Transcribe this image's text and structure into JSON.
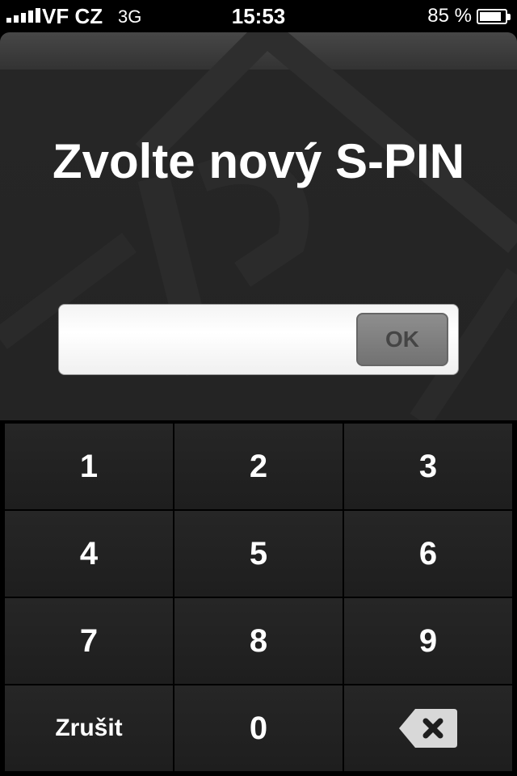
{
  "status_bar": {
    "carrier": "VF CZ",
    "network": "3G",
    "time": "15:53",
    "battery_percent": "85 %",
    "battery_level": 0.85,
    "signal_bars": 5
  },
  "dialog": {
    "title": "Zvolte nový S-PIN",
    "pin_value": "",
    "ok_label": "OK"
  },
  "keypad": {
    "keys": [
      "1",
      "2",
      "3",
      "4",
      "5",
      "6",
      "7",
      "8",
      "9"
    ],
    "cancel_label": "Zrušit",
    "zero_label": "0",
    "backspace_icon": "backspace-icon"
  }
}
